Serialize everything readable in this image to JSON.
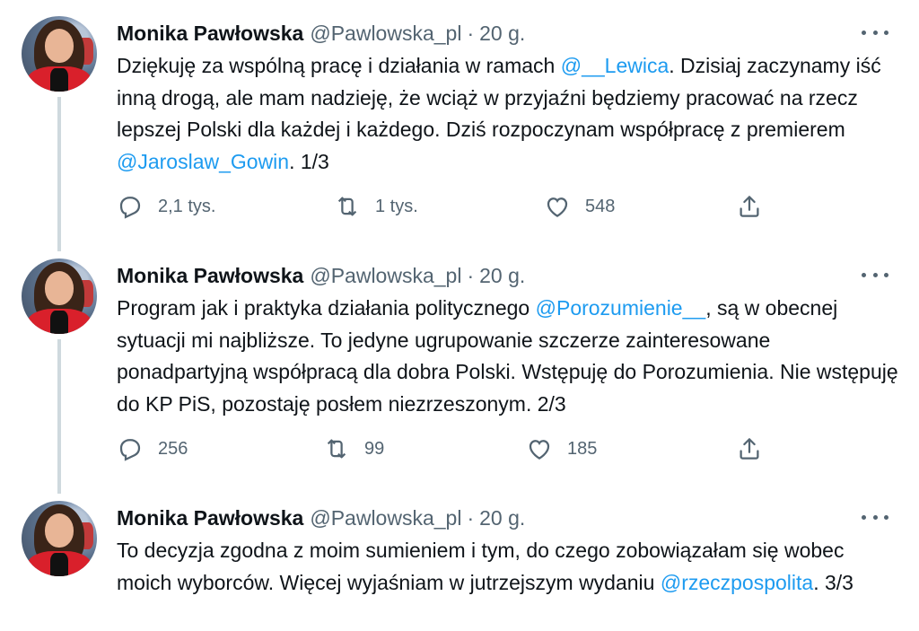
{
  "colors": {
    "text": "#0f1419",
    "secondary": "#536471",
    "link": "#1d9bf0",
    "thread_line": "#cfd9de"
  },
  "tweets": [
    {
      "name": "Monika Pawłowska",
      "handle": "@Pawlowska_pl",
      "dot": "·",
      "time": "20 g.",
      "parts": [
        "Dziękuję za wspólną pracę i działania w ramach ",
        "@__Lewica",
        ". Dzisiaj zaczynamy iść inną drogą, ale mam nadzieję, że wciąż w przyjaźni będziemy pracować na rzecz lepszej Polski dla każdej i każdego. Dziś rozpoczynam współpracę z premierem ",
        "@Jaroslaw_Gowin",
        ". 1/3"
      ],
      "replies": "2,1 tys.",
      "retweets": "1 tys.",
      "likes": "548"
    },
    {
      "name": "Monika Pawłowska",
      "handle": "@Pawlowska_pl",
      "dot": "·",
      "time": "20 g.",
      "parts": [
        "Program jak i praktyka działania politycznego ",
        "@Porozumienie__",
        ", są w obecnej sytuacji mi najbliższe. To jedyne ugrupowanie szczerze zainteresowane ponadpartyjną współpracą dla dobra Polski. Wstępuję do Porozumienia. Nie wstępuję do KP PiS, pozostaję posłem niezrzeszonym. 2/3"
      ],
      "replies": "256",
      "retweets": "99",
      "likes": "185"
    },
    {
      "name": "Monika Pawłowska",
      "handle": "@Pawlowska_pl",
      "dot": "·",
      "time": "20 g.",
      "parts": [
        "To decyzja zgodna z moim sumieniem i tym, do czego zobowiązałam się wobec moich wyborców. Więcej wyjaśniam w jutrzejszym wydaniu ",
        "@rzeczpospolita",
        ". 3/3"
      ]
    }
  ]
}
